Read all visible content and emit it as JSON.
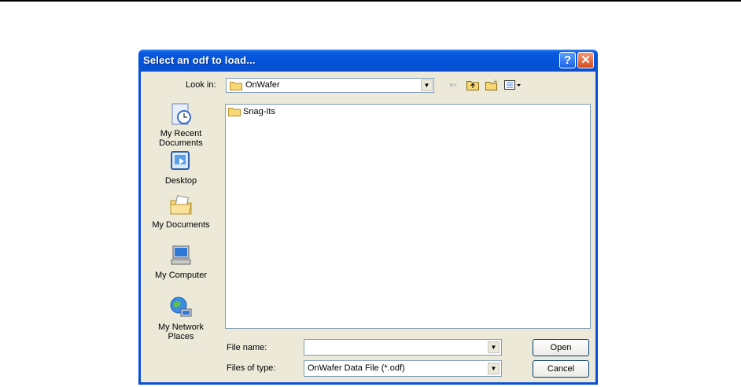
{
  "dialog": {
    "title": "Select an odf to load...",
    "help_button": "?",
    "close_button": "✕"
  },
  "look_in": {
    "label": "Look in:",
    "value": "OnWafer"
  },
  "toolbar": {
    "back_icon": "back-arrow-icon",
    "up_icon": "up-one-level-icon",
    "new_folder_icon": "new-folder-icon",
    "views_icon": "views-menu-icon"
  },
  "places": [
    {
      "label": "My Recent Documents",
      "line1": "My Recent",
      "line2": "Documents",
      "icon": "recent-documents-icon"
    },
    {
      "label": "Desktop",
      "line1": "Desktop",
      "line2": "",
      "icon": "desktop-icon"
    },
    {
      "label": "My Documents",
      "line1": "My Documents",
      "line2": "",
      "icon": "my-documents-icon"
    },
    {
      "label": "My Computer",
      "line1": "My Computer",
      "line2": "",
      "icon": "my-computer-icon"
    },
    {
      "label": "My Network Places",
      "line1": "My Network",
      "line2": "Places",
      "icon": "network-places-icon"
    }
  ],
  "files": [
    {
      "name": "Snag-Its",
      "type": "folder"
    }
  ],
  "file_name": {
    "label": "File name:",
    "value": ""
  },
  "file_type": {
    "label": "Files of type:",
    "value": "OnWafer Data File (*.odf)"
  },
  "buttons": {
    "open": "Open",
    "cancel": "Cancel"
  },
  "colors": {
    "title_bar": "#0a4fd6",
    "dialog_face": "#ece9d8",
    "field_border": "#7f9db9"
  }
}
